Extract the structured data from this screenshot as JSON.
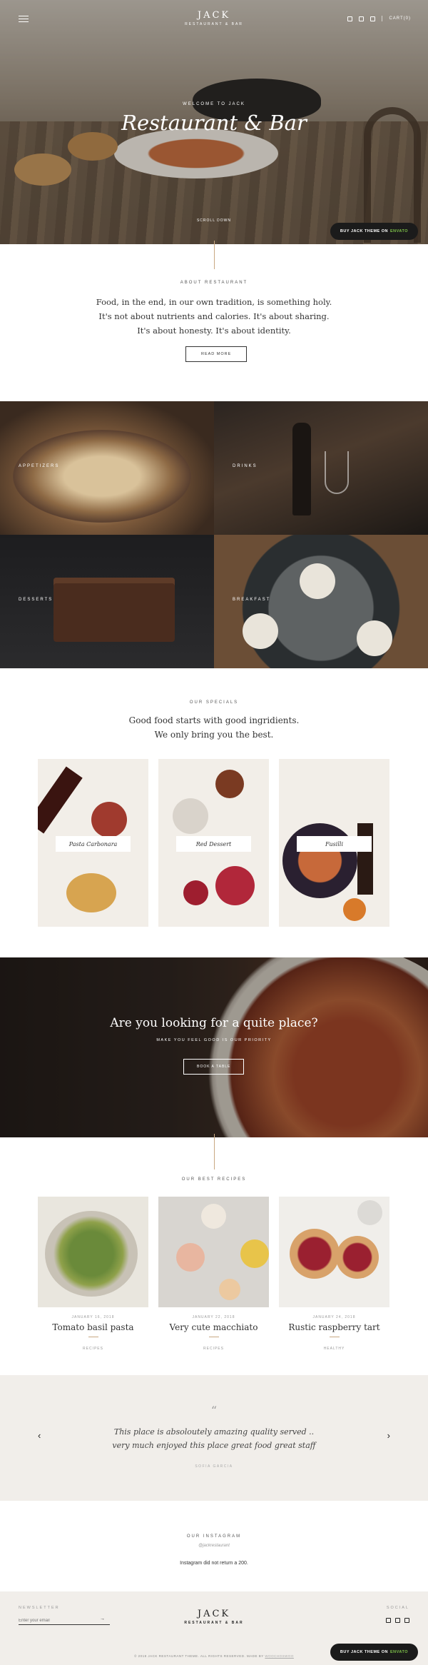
{
  "header": {
    "brand_name": "JACK",
    "brand_sub": "RESTAURANT & BAR",
    "cart_label": "CART(0)",
    "social_icons": [
      "facebook-icon",
      "instagram-icon",
      "pinterest-icon"
    ]
  },
  "hero": {
    "kicker": "WELCOME TO JACK",
    "title": "Restaurant & Bar",
    "scroll_label": "SCROLL DOWN"
  },
  "promo": {
    "buy_label": "BUY JACK THEME ON",
    "market": "ENVATO",
    "market_color": "#7ec24a"
  },
  "about": {
    "label": "ABOUT RESTAURANT",
    "text": "Food, in the end, in our own tradition, is something holy. It's not about nutrients and calories. It's about sharing. It's about honesty. It's about identity.",
    "button": "READ MORE"
  },
  "menu_tiles": [
    {
      "label": "APPETIZERS"
    },
    {
      "label": "DRINKS"
    },
    {
      "label": "DESSERTS"
    },
    {
      "label": "BREAKFAST"
    }
  ],
  "specials": {
    "label": "OUR SPECIALS",
    "line1": "Good food starts with good ingridients.",
    "line2": "We only bring you the best.",
    "items": [
      {
        "name": "Pasta Carbonara"
      },
      {
        "name": "Red Dessert"
      },
      {
        "name": "Fusilli"
      }
    ]
  },
  "quiet": {
    "title": "Are you looking for a quite place?",
    "subtitle": "MAKE YOU FEEL GOOD IS OUR PRIORITY",
    "button": "BOOK A TABLE"
  },
  "recipes": {
    "label": "OUR BEST RECIPES",
    "items": [
      {
        "date": "JANUARY 16, 2018",
        "title": "Tomato basil pasta",
        "category": "RECIPES"
      },
      {
        "date": "JANUARY 22, 2018",
        "title": "Very cute macchiato",
        "category": "RECIPES"
      },
      {
        "date": "JANUARY 24, 2018",
        "title": "Rustic raspberry tart",
        "category": "HEALTHY"
      }
    ]
  },
  "testimonial": {
    "quote_mark": "“",
    "text": "This place is absoloutely amazing quality served .. very much enjoyed this place great food great staff",
    "author": "SOFIA GARCIA"
  },
  "instagram": {
    "label": "OUR INSTAGRAM",
    "handle": "@jackrestaurant",
    "message": "Instagram did not return a 200."
  },
  "footer": {
    "newsletter_label": "NEWSLETTER",
    "email_placeholder": "Enter your email",
    "send_arrow": "→",
    "brand_name": "JACK",
    "brand_sub": "RESTAURANT & BAR",
    "social_label": "SOCIAL",
    "copyright": "© 2018 JACK RESTAURANT THEME. ALL RIGHTS RESERVED. MADE BY",
    "copyright_link": "WOOCHOSWOO"
  }
}
